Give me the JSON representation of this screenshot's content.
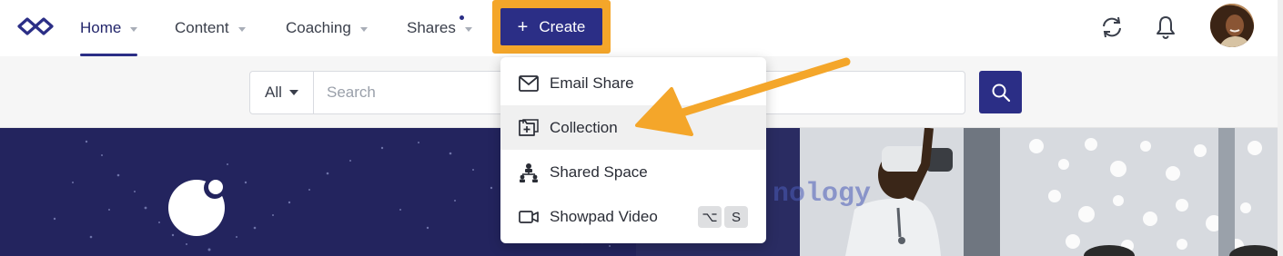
{
  "nav": {
    "items": [
      {
        "label": "Home",
        "has_caret": true,
        "active": true
      },
      {
        "label": "Content",
        "has_caret": true
      },
      {
        "label": "Coaching",
        "has_caret": true
      },
      {
        "label": "Shares",
        "has_caret": true,
        "notification_dot": true
      }
    ],
    "create_label": "Create",
    "create_icon": "plus-icon",
    "right_icons": [
      "sync-icon",
      "bell-icon"
    ],
    "accent_color": "#2b2e86",
    "highlight_color": "#f4a62a"
  },
  "search": {
    "filter_value": "All",
    "placeholder": "Search",
    "value": ""
  },
  "create_menu": {
    "items": [
      {
        "label": "Email Share",
        "icon": "envelope-icon"
      },
      {
        "label": "Collection",
        "icon": "folder-plus-icon"
      },
      {
        "label": "Shared Space",
        "icon": "people-network-icon"
      },
      {
        "label": "Showpad Video",
        "icon": "video-camera-icon",
        "shortcut": [
          "⌥",
          "S"
        ]
      }
    ]
  },
  "hero": {
    "right_overlay_text": "nology"
  }
}
